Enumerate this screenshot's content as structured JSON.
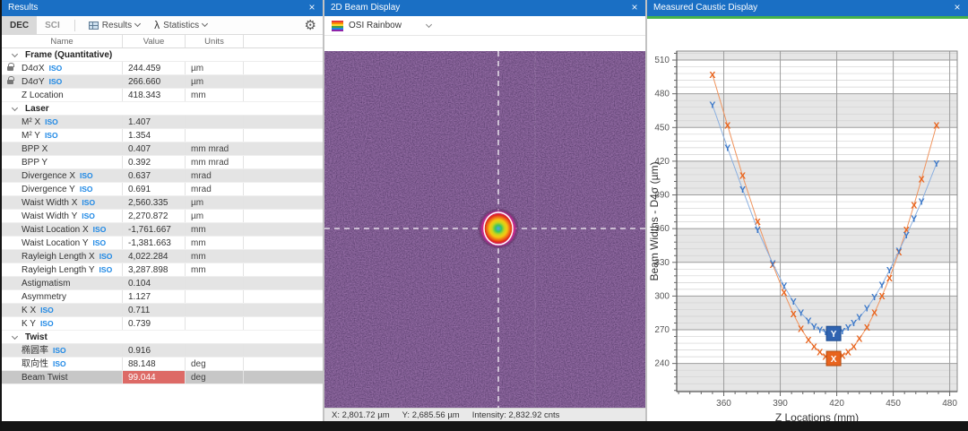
{
  "icons": {
    "close": "×",
    "gear": "⚙",
    "lambda": "λ"
  },
  "results_panel": {
    "title": "Results",
    "tabs": [
      {
        "label": "DEC",
        "active": true
      },
      {
        "label": "SCI",
        "active": false
      }
    ],
    "results_menu_label": "Results",
    "statistics_menu_label": "Statistics",
    "columns": [
      "Name",
      "Value",
      "Units",
      ""
    ],
    "rows": [
      {
        "type": "section",
        "label": "Frame (Quantitative)"
      },
      {
        "type": "row",
        "name": "D4σX",
        "iso": true,
        "lock": true,
        "value": "244.459",
        "units": "µm",
        "shade": false
      },
      {
        "type": "row",
        "name": "D4σY",
        "iso": true,
        "lock": true,
        "value": "266.660",
        "units": "µm",
        "shade": true
      },
      {
        "type": "row",
        "name": "Z Location",
        "iso": false,
        "value": "418.343",
        "units": "mm",
        "shade": false
      },
      {
        "type": "section",
        "label": "Laser"
      },
      {
        "type": "row",
        "name": "M² X",
        "iso": true,
        "value": "1.407",
        "units": "",
        "shade": true
      },
      {
        "type": "row",
        "name": "M² Y",
        "iso": true,
        "value": "1.354",
        "units": "",
        "shade": false
      },
      {
        "type": "row",
        "name": "BPP X",
        "iso": false,
        "value": "0.407",
        "units": "mm mrad",
        "shade": true
      },
      {
        "type": "row",
        "name": "BPP Y",
        "iso": false,
        "value": "0.392",
        "units": "mm mrad",
        "shade": false
      },
      {
        "type": "row",
        "name": "Divergence X",
        "iso": true,
        "value": "0.637",
        "units": "mrad",
        "shade": true
      },
      {
        "type": "row",
        "name": "Divergence Y",
        "iso": true,
        "value": "0.691",
        "units": "mrad",
        "shade": false
      },
      {
        "type": "row",
        "name": "Waist Width X",
        "iso": true,
        "value": "2,560.335",
        "units": "µm",
        "shade": true
      },
      {
        "type": "row",
        "name": "Waist Width Y",
        "iso": true,
        "value": "2,270.872",
        "units": "µm",
        "shade": false
      },
      {
        "type": "row",
        "name": "Waist Location X",
        "iso": true,
        "value": "-1,761.667",
        "units": "mm",
        "shade": true
      },
      {
        "type": "row",
        "name": "Waist Location Y",
        "iso": true,
        "value": "-1,381.663",
        "units": "mm",
        "shade": false
      },
      {
        "type": "row",
        "name": "Rayleigh Length X",
        "iso": true,
        "value": "4,022.284",
        "units": "mm",
        "shade": true
      },
      {
        "type": "row",
        "name": "Rayleigh Length Y",
        "iso": true,
        "value": "3,287.898",
        "units": "mm",
        "shade": false
      },
      {
        "type": "row",
        "name": "Astigmatism",
        "iso": false,
        "value": "0.104",
        "units": "",
        "shade": true
      },
      {
        "type": "row",
        "name": "Asymmetry",
        "iso": false,
        "value": "1.127",
        "units": "",
        "shade": false
      },
      {
        "type": "row",
        "name": "K X",
        "iso": true,
        "value": "0.711",
        "units": "",
        "shade": true
      },
      {
        "type": "row",
        "name": "K Y",
        "iso": true,
        "value": "0.739",
        "units": "",
        "shade": false
      },
      {
        "type": "section",
        "label": "Twist"
      },
      {
        "type": "row",
        "name": "椭圆率",
        "iso": true,
        "value": "0.916",
        "units": "",
        "shade": true
      },
      {
        "type": "row",
        "name": "取向性",
        "iso": true,
        "value": "88.148",
        "units": "deg",
        "shade": false
      },
      {
        "type": "row",
        "name": "Beam Twist",
        "iso": false,
        "value": "99.044",
        "units": "deg",
        "shade": true,
        "selected": true,
        "value_alert": true
      }
    ]
  },
  "beam_panel": {
    "title": "2D Beam Display",
    "colormap_label": "OSI Rainbow",
    "status": {
      "x": "X: 2,801.72 µm",
      "y": "Y: 2,685.56 µm",
      "intensity": "Intensity: 2,832.92 cnts"
    }
  },
  "caustic_panel": {
    "title": "Measured Caustic Display"
  },
  "chart_data": {
    "type": "scatter",
    "title": "",
    "xlabel": "Z Locations (mm)",
    "ylabel": "Beam Widths - D4σ (µm)",
    "xlim": [
      335,
      484
    ],
    "ylim": [
      215,
      518
    ],
    "xticks": [
      360,
      390,
      420,
      450,
      480
    ],
    "yticks": [
      240,
      270,
      300,
      330,
      360,
      390,
      420,
      450,
      480,
      510
    ],
    "x_minor_step": 6,
    "y_minor_step": 6,
    "grid": true,
    "legend": false,
    "x": [
      354,
      362,
      370,
      378,
      386,
      392,
      397,
      401,
      405,
      408,
      411,
      414,
      417,
      420,
      423,
      426,
      429,
      432,
      436,
      440,
      444,
      448,
      453,
      457,
      461,
      465,
      473
    ],
    "series": [
      {
        "name": "X",
        "marker_glyph": "X",
        "marker_color": "#e8641e",
        "line_color": "#f0945e",
        "values": [
          497,
          452,
          407,
          366,
          328,
          303,
          284,
          271,
          261,
          255,
          250,
          246,
          245,
          245,
          247,
          250,
          255,
          262,
          272,
          285,
          300,
          316,
          339,
          359,
          381,
          404,
          452
        ]
      },
      {
        "name": "Y",
        "marker_glyph": "Y",
        "marker_color": "#3c78c8",
        "line_color": "#8cb0e0",
        "values": [
          470,
          432,
          395,
          359,
          329,
          309,
          295,
          285,
          278,
          273,
          270,
          268,
          267,
          267,
          269,
          272,
          276,
          281,
          289,
          299,
          310,
          323,
          340,
          354,
          369,
          384,
          418
        ]
      }
    ],
    "current_frame": {
      "z": 418.343,
      "x_width": 244.459,
      "y_width": 266.66,
      "x_color": "#e8641e",
      "y_color": "#2f63b0"
    }
  }
}
